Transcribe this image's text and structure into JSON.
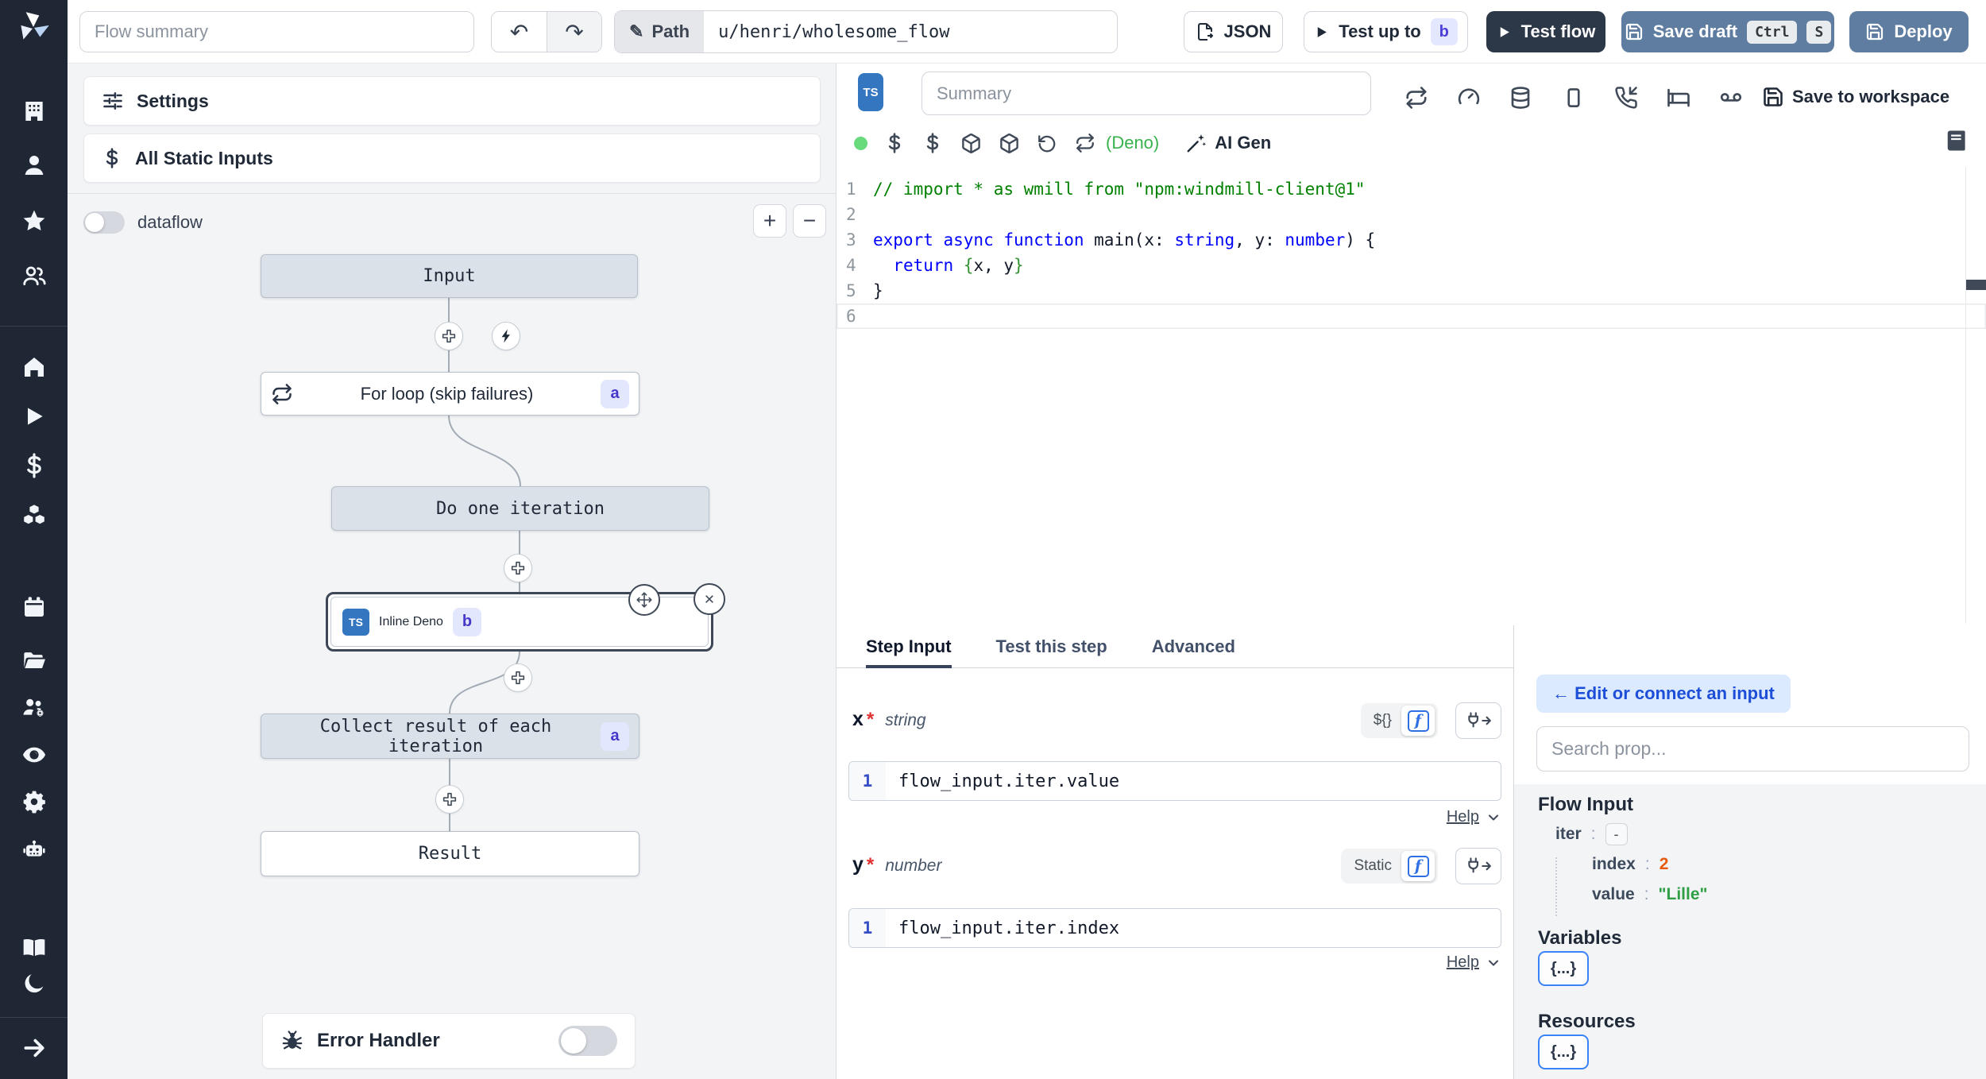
{
  "topbar": {
    "flow_summary_placeholder": "Flow summary",
    "path_label": "Path",
    "path_value": "u/henri/wholesome_flow",
    "json_button": "JSON",
    "test_up_to": "Test up to",
    "test_up_to_badge": "b",
    "test_flow": "Test flow",
    "save_draft": "Save draft",
    "kbd_ctrl": "Ctrl",
    "kbd_s": "S",
    "deploy": "Deploy"
  },
  "flow_panel": {
    "settings": "Settings",
    "all_static_inputs": "All Static Inputs",
    "dataflow_label": "dataflow",
    "zoom_in": "+",
    "zoom_out": "−",
    "nodes": {
      "input": "Input",
      "forloop": "For loop (skip failures)",
      "forloop_badge": "a",
      "do_one_iteration": "Do one iteration",
      "inline_deno": "Inline Deno",
      "inline_deno_badge": "b",
      "inline_deno_lang": "TS",
      "collect": "Collect result of each iteration",
      "collect_badge": "a",
      "result": "Result"
    },
    "error_handler": "Error Handler"
  },
  "editor": {
    "lang_badge": "TS",
    "summary_placeholder": "Summary",
    "save_to_workspace": "Save to workspace",
    "runtime": "(Deno)",
    "ai_gen": "AI Gen",
    "code_lines": [
      {
        "segs": [
          [
            "// import * as wmill from \"npm:windmill-client@1\"",
            "comment"
          ]
        ]
      },
      {
        "segs": []
      },
      {
        "segs": [
          [
            "export async function ",
            "kw"
          ],
          [
            "main",
            "fn"
          ],
          [
            "(x: ",
            "plain"
          ],
          [
            "string",
            "kw"
          ],
          [
            ", y: ",
            "plain"
          ],
          [
            "number",
            "kw"
          ],
          [
            ") {",
            "plain"
          ]
        ]
      },
      {
        "segs": [
          [
            "  ",
            "plain"
          ],
          [
            "return ",
            "kw"
          ],
          [
            "{",
            "brace"
          ],
          [
            "x, y",
            "plain"
          ],
          [
            "}",
            "brace"
          ]
        ]
      },
      {
        "segs": [
          [
            "}",
            "plain"
          ]
        ]
      },
      {
        "segs": [],
        "current": true
      }
    ]
  },
  "step_panel": {
    "tabs": [
      "Step Input",
      "Test this step",
      "Advanced"
    ],
    "fields": [
      {
        "name": "x",
        "required": "*",
        "type": "string",
        "mode_label": "${}",
        "line_no": "1",
        "expr": "flow_input.iter.value",
        "help": "Help"
      },
      {
        "name": "y",
        "required": "*",
        "type": "number",
        "mode_label": "Static",
        "line_no": "1",
        "expr": "flow_input.iter.index",
        "help": "Help"
      }
    ]
  },
  "context_panel": {
    "edit_button": "← Edit or connect an input",
    "search_placeholder": "Search prop...",
    "flow_input_title": "Flow Input",
    "tree": [
      {
        "key": "iter",
        "colon": ":",
        "value": "-",
        "kind": "collapse",
        "indent": 0
      },
      {
        "key": "index",
        "colon": ":",
        "value": "2",
        "kind": "number",
        "indent": 1
      },
      {
        "key": "value",
        "colon": ":",
        "value": "\"Lille\"",
        "kind": "string",
        "indent": 1
      }
    ],
    "variables_title": "Variables",
    "variables_chip": "{...}",
    "resources_title": "Resources",
    "resources_chip": "{...}"
  },
  "icons": {
    "undo": "↶",
    "redo": "↷",
    "pencil": "✎",
    "zoom_in": "+",
    "zoom_out": "−",
    "collapse_minus": "-",
    "function": "f"
  }
}
